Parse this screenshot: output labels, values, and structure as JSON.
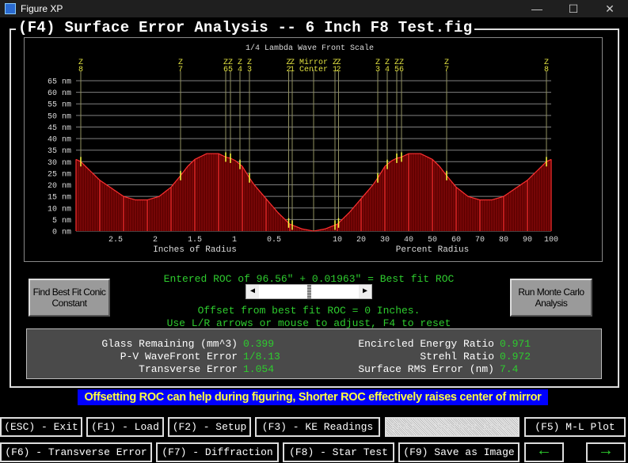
{
  "window": {
    "title": "Figure XP",
    "controls": [
      "minimize",
      "maximize",
      "close"
    ]
  },
  "main_title": "(F4) Surface Error Analysis -- 6 Inch F8 Test.fig",
  "chart_data": {
    "type": "area",
    "title": "1/4 Lambda Wave Front Scale",
    "y_tick_labels": [
      "65 nm",
      "60 nm",
      "55 nm",
      "50 nm",
      "45 nm",
      "40 nm",
      "35 nm",
      "30 nm",
      "25 nm",
      "20 nm",
      "15 nm",
      "10 nm",
      "5 nm",
      "0 nm"
    ],
    "ylim": [
      0,
      65
    ],
    "left_axis": {
      "label": "Inches of Radius",
      "ticks": [
        "2.5",
        "2",
        "1.5",
        "1",
        "0.5"
      ],
      "tick_values": [
        2.5,
        2,
        1.5,
        1,
        0.5
      ],
      "range": [
        3,
        0
      ]
    },
    "right_axis": {
      "label": "Percent Radius",
      "ticks": [
        "10",
        "20",
        "30",
        "40",
        "50",
        "60",
        "70",
        "80",
        "90",
        "100"
      ],
      "tick_values": [
        10,
        20,
        30,
        40,
        50,
        60,
        70,
        80,
        90,
        100
      ],
      "range": [
        0,
        100
      ]
    },
    "center_label": [
      "Mirror",
      "Center"
    ],
    "grid": true,
    "profile": {
      "percent_radius": [
        0,
        5,
        10,
        15,
        20,
        25,
        27,
        30,
        33,
        35,
        37,
        40,
        45,
        50,
        53,
        56,
        60,
        65,
        70,
        75,
        80,
        85,
        90,
        95,
        98,
        100
      ],
      "nm": [
        0,
        1,
        3,
        8,
        14,
        20,
        23,
        28,
        30.5,
        31.5,
        32,
        33.5,
        33.5,
        31,
        28,
        24,
        19,
        15,
        13.5,
        13.5,
        15,
        18.5,
        22,
        27,
        30,
        31
      ]
    },
    "zernike_markers": [
      {
        "label": "Z1",
        "percent": 9
      },
      {
        "label": "Z2",
        "percent": 10.5
      },
      {
        "label": "Z3",
        "percent": 27
      },
      {
        "label": "Z4",
        "percent": 31
      },
      {
        "label": "Z5",
        "percent": 35
      },
      {
        "label": "Z6",
        "percent": 37
      },
      {
        "label": "Z7",
        "percent": 56
      },
      {
        "label": "Z8",
        "percent": 98
      }
    ],
    "colors": {
      "curve": "#ff3030",
      "fill": "#5a0000",
      "markers": "#e0e040",
      "grid": "#808080"
    }
  },
  "controls": {
    "conic_button": "Find Best Fit Conic Constant",
    "monte_carlo_button": "Run Monte Carlo Analysis",
    "roc_text": "Entered ROC of 96.56\" + 0.01963\" = Best fit ROC",
    "offset_text": "Offset from best fit ROC = 0 Inches.",
    "help_text": "Use L/R arrows or mouse to adjust, F4 to reset",
    "slider_position": 0.5
  },
  "stats": {
    "glass_remaining": {
      "label": "Glass Remaining (mm^3)",
      "value": "0.399"
    },
    "pv_error": {
      "label": "P-V WaveFront Error",
      "value": "1/8.13"
    },
    "transverse_error": {
      "label": "Transverse Error",
      "value": "1.054"
    },
    "encircled_energy": {
      "label": "Encircled Energy Ratio",
      "value": "0.971"
    },
    "strehl": {
      "label": "Strehl Ratio",
      "value": "0.972"
    },
    "rms_error": {
      "label": "Surface RMS Error (nm)",
      "value": "7.4"
    }
  },
  "message": "Offsetting ROC can help during figuring, Shorter ROC effectively raises center of mirror",
  "buttons": {
    "exit": "(ESC) - Exit",
    "load": "(F1) - Load",
    "setup": "(F2) - Setup",
    "ke": "(F3) - KE Readings",
    "surface": "(F4) - Surface Error",
    "ml": "(F5) M-L Plot",
    "transverse": "(F6) - Transverse Error",
    "diffraction": "(F7) - Diffraction",
    "star": "(F8) - Star Test",
    "save": "(F9) Save as Image",
    "prev": "←",
    "next": "→"
  }
}
